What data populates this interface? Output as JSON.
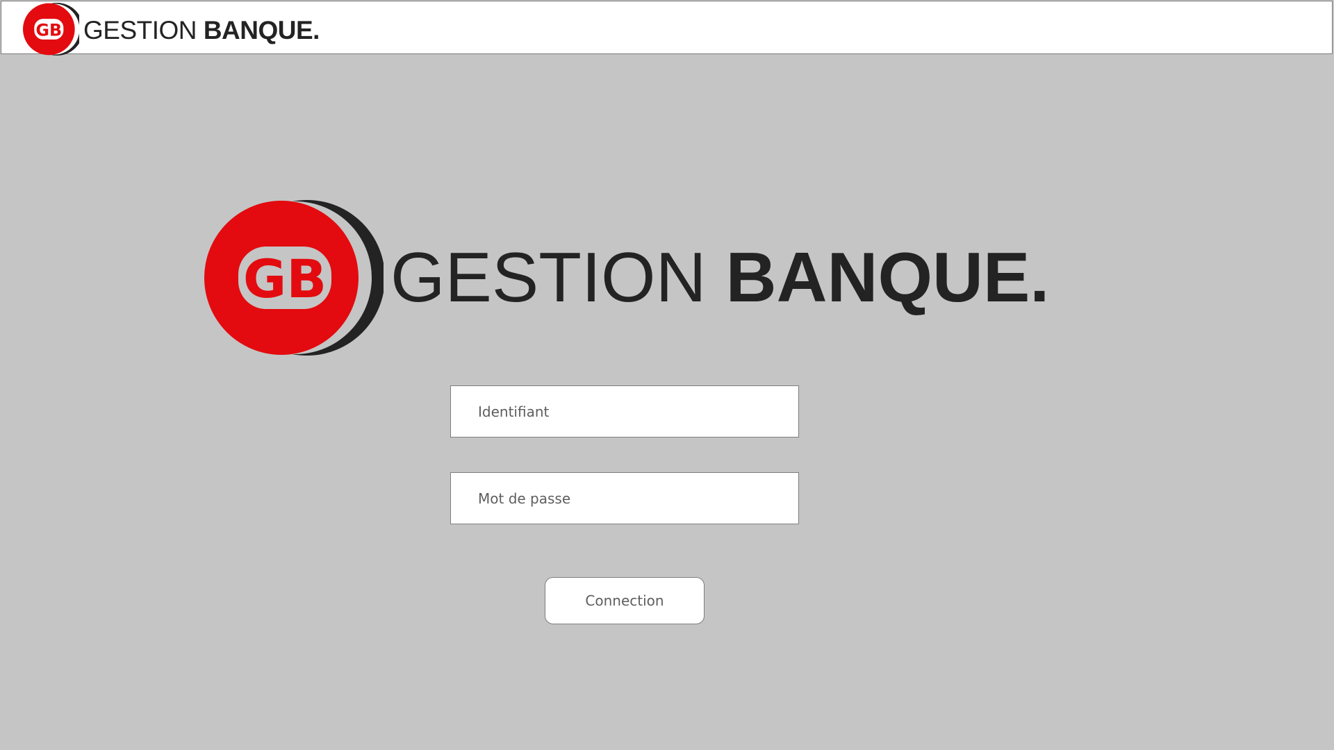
{
  "brand": {
    "monogram": "GB",
    "name_light": "GESTION",
    "name_bold": "BANQUE.",
    "colors": {
      "red": "#e30b0f",
      "dark": "#232323",
      "background": "#c5c5c5"
    }
  },
  "login": {
    "username_placeholder": "Identifiant",
    "password_placeholder": "Mot de passe",
    "submit_label": "Connection"
  }
}
